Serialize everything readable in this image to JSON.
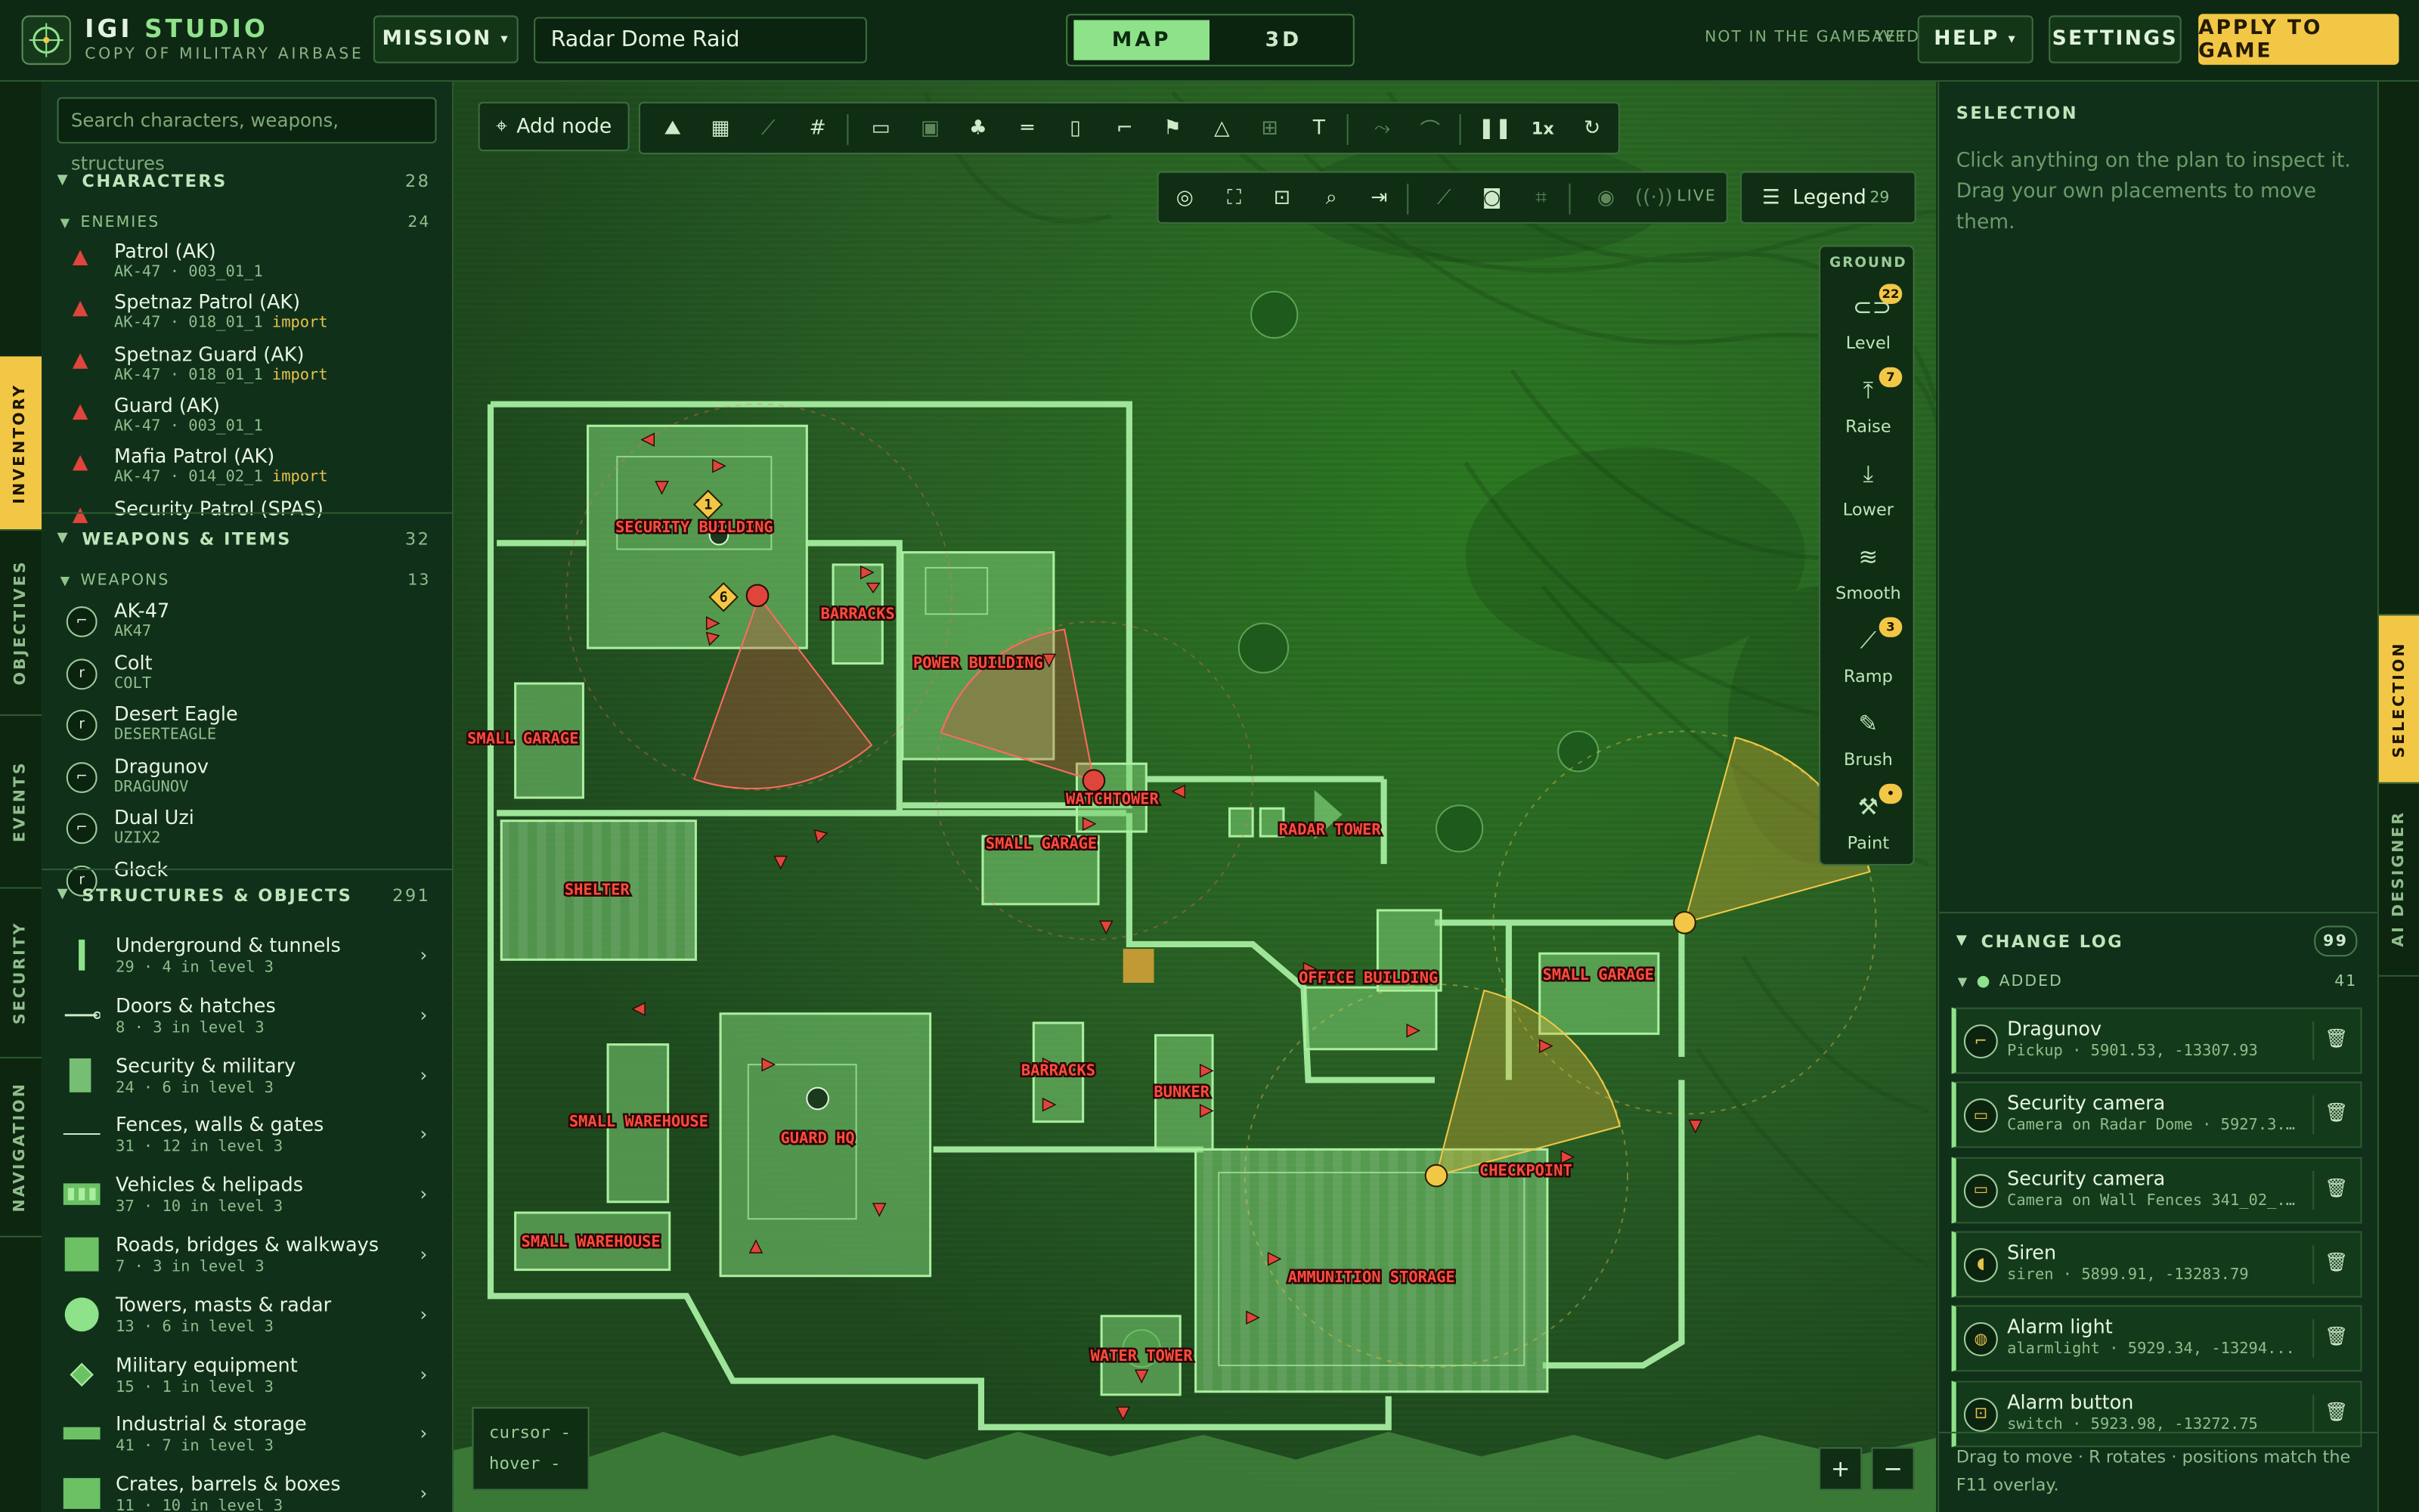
{
  "app": {
    "title_a": "IGI",
    "title_b": "STUDIO",
    "subtitle": "COPY OF MILITARY AIRBASE"
  },
  "topbar": {
    "mission_label": "MISSION",
    "mission_name": "Radar Dome Raid",
    "view_map": "MAP",
    "view_3d": "3D",
    "status_not_in_game": "NOT IN THE GAME YET",
    "status_saved": "SAVED",
    "help_label": "HELP",
    "settings_label": "SETTINGS",
    "apply_label": "APPLY TO GAME"
  },
  "vtabs": [
    "INVENTORY",
    "OBJECTIVES",
    "EVENTS",
    "SECURITY",
    "NAVIGATION"
  ],
  "rtabs": [
    "SELECTION",
    "AI DESIGNER"
  ],
  "left": {
    "search_placeholder": "Search characters, weapons, structures",
    "characters": {
      "label": "CHARACTERS",
      "count": "28",
      "sub": {
        "label": "ENEMIES",
        "count": "24"
      },
      "items": [
        {
          "name": "Patrol (AK)",
          "detail": "AK-47 · 003_01_1",
          "tag": ""
        },
        {
          "name": "Spetnaz Patrol (AK)",
          "detail": "AK-47 · 018_01_1",
          "tag": "import"
        },
        {
          "name": "Spetnaz Guard (AK)",
          "detail": "AK-47 · 018_01_1",
          "tag": "import"
        },
        {
          "name": "Guard (AK)",
          "detail": "AK-47 · 003_01_1",
          "tag": ""
        },
        {
          "name": "Mafia Patrol (AK)",
          "detail": "AK-47 · 014_02_1",
          "tag": "import"
        },
        {
          "name": "Security Patrol (SPAS)",
          "detail": "",
          "tag": ""
        }
      ]
    },
    "weapons": {
      "label": "WEAPONS & ITEMS",
      "count": "32",
      "sub": {
        "label": "WEAPONS",
        "count": "13"
      },
      "items": [
        {
          "name": "AK-47",
          "detail": "AK47"
        },
        {
          "name": "Colt",
          "detail": "COLT"
        },
        {
          "name": "Desert Eagle",
          "detail": "DESERTEAGLE"
        },
        {
          "name": "Dragunov",
          "detail": "DRAGUNOV"
        },
        {
          "name": "Dual Uzi",
          "detail": "UZIX2"
        },
        {
          "name": "Glock",
          "detail": ""
        }
      ]
    },
    "structures": {
      "label": "STRUCTURES & OBJECTS",
      "count": "291",
      "items": [
        {
          "name": "Underground & tunnels",
          "detail": "29 · 4 in level 3"
        },
        {
          "name": "Doors & hatches",
          "detail": "8 · 3 in level 3"
        },
        {
          "name": "Security & military",
          "detail": "24 · 6 in level 3"
        },
        {
          "name": "Fences, walls & gates",
          "detail": "31 · 12 in level 3"
        },
        {
          "name": "Vehicles & helipads",
          "detail": "37 · 10 in level 3"
        },
        {
          "name": "Roads, bridges & walkways",
          "detail": "7 · 3 in level 3"
        },
        {
          "name": "Towers, masts & radar",
          "detail": "13 · 6 in level 3"
        },
        {
          "name": "Military equipment",
          "detail": "15 · 1 in level 3"
        },
        {
          "name": "Industrial & storage",
          "detail": "41 · 7 in level 3"
        },
        {
          "name": "Crates, barrels & boxes",
          "detail": "11 · 10 in level 3"
        }
      ]
    }
  },
  "map": {
    "add_node": "Add node",
    "live": "LIVE",
    "legend_label": "Legend",
    "legend_count": "29",
    "speed": "1x",
    "cursor_label": "cursor -",
    "hover_label": "hover -",
    "zoom_in": "+",
    "zoom_out": "−",
    "ground": {
      "title": "GROUND",
      "tools": [
        {
          "label": "Level",
          "badge": "22"
        },
        {
          "label": "Raise",
          "badge": "7"
        },
        {
          "label": "Lower",
          "badge": ""
        },
        {
          "label": "Smooth",
          "badge": ""
        },
        {
          "label": "Ramp",
          "badge": "3"
        },
        {
          "label": "Brush",
          "badge": ""
        },
        {
          "label": "Paint",
          "badge": "•"
        }
      ]
    },
    "labels": {
      "security_building": "SECURITY BUILDING",
      "barracks_1": "BARRACKS",
      "power_building": "POWER BUILDING",
      "small_garage_1": "SMALL GARAGE",
      "watchtower": "WATCHTOWER",
      "small_garage_2": "SMALL GARAGE",
      "radar_tower": "RADAR TOWER",
      "shelter": "SHELTER",
      "office_building": "OFFICE BUILDING",
      "small_garage_3": "SMALL GARAGE",
      "barracks_2": "BARRACKS",
      "bunker": "BUNKER",
      "small_warehouse_1": "SMALL WAREHOUSE",
      "guard_hq": "GUARD HQ",
      "checkpoint": "CHECKPOINT",
      "small_warehouse_2": "SMALL WAREHOUSE",
      "ammunition_storage": "AMMUNITION STORAGE",
      "water_tower": "WATER TOWER",
      "marker_1": "1",
      "marker_6": "6"
    }
  },
  "right": {
    "selection_title": "SELECTION",
    "selection_text": "Click anything on the plan to inspect it. Drag your own placements to move them.",
    "changelog_title": "CHANGE LOG",
    "changelog_count": "99",
    "added_label": "ADDED",
    "added_count": "41",
    "items": [
      {
        "name": "Dragunov",
        "detail": "Pickup · 5901.53, -13307.93"
      },
      {
        "name": "Security camera",
        "detail": "Camera on Radar Dome · 5927.3..."
      },
      {
        "name": "Security camera",
        "detail": "Camera on Wall Fences 341_02_..."
      },
      {
        "name": "Siren",
        "detail": "siren · 5899.91, -13283.79"
      },
      {
        "name": "Alarm light",
        "detail": "alarmlight · 5929.34, -13294..."
      },
      {
        "name": "Alarm button",
        "detail": "switch · 5923.98, -13272.75"
      }
    ],
    "footer": "Drag to move · R rotates · positions match the F11 overlay."
  },
  "colors": {
    "accent": "#8ee28a",
    "apply": "#f3c746",
    "enemy": "#e0453c",
    "label_red": "#ff4b3f"
  }
}
